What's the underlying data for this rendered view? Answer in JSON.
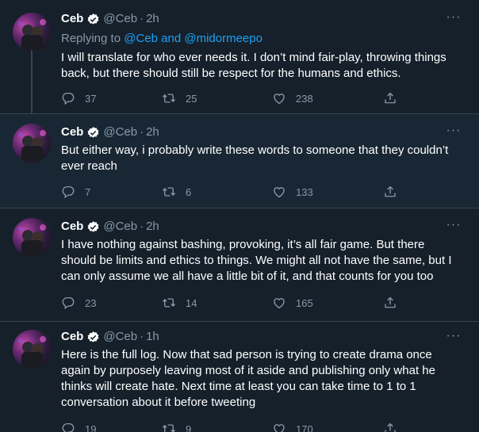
{
  "tweets": [
    {
      "name": "Ceb",
      "handle": "@Ceb",
      "time": "2h",
      "replying_prefix": "Replying to",
      "replying_1": "@Ceb",
      "replying_and": "and",
      "replying_2": "@midormeepo",
      "text": "I will translate for who ever needs it. I don’t mind fair-play, throwing things back, but there should still be respect for the humans and ethics.",
      "replies": "37",
      "retweets": "25",
      "likes": "238"
    },
    {
      "name": "Ceb",
      "handle": "@Ceb",
      "time": "2h",
      "text": "But either way, i probably write these words to someone that they couldn’t ever reach",
      "replies": "7",
      "retweets": "6",
      "likes": "133"
    },
    {
      "name": "Ceb",
      "handle": "@Ceb",
      "time": "2h",
      "text": "I have nothing against bashing, provoking, it’s all fair game. But there should be limits and ethics to things. We might all not have the same, but I can only assume we all have a little bit of it, and that counts for you too",
      "replies": "23",
      "retweets": "14",
      "likes": "165"
    },
    {
      "name": "Ceb",
      "handle": "@Ceb",
      "time": "1h",
      "text": "Here is the full log. Now that sad person is trying to create drama once again by purposely leaving most of it aside and publishing only what he thinks will create hate. Next time at least you can take time to 1 to 1 conversation about it before tweeting",
      "replies": "19",
      "retweets": "9",
      "likes": "170"
    }
  ],
  "colors": {
    "background": "#15202b",
    "divider": "#38444d",
    "muted": "#8899a6",
    "link": "#1da1f2"
  },
  "icons": [
    "verified-icon",
    "more-icon",
    "reply-icon",
    "retweet-icon",
    "like-icon",
    "share-icon"
  ]
}
